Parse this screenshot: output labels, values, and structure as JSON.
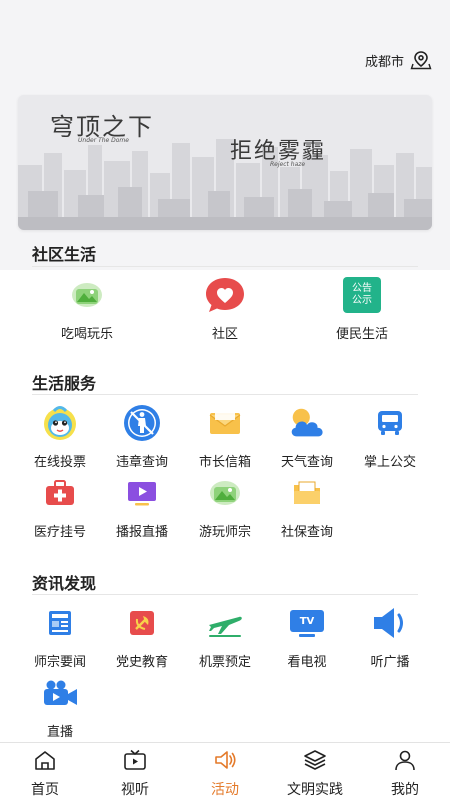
{
  "location": {
    "city": "成都市"
  },
  "banner": {
    "title_left": "穹顶之下",
    "subtitle_left": "Under The Dome",
    "title_right": "拒绝雾霾",
    "subtitle_right": "Reject haze"
  },
  "community": {
    "title": "社区生活",
    "items": [
      {
        "label": "吃喝玩乐",
        "icon": "mountain-image-icon"
      },
      {
        "label": "社区",
        "icon": "heart-bubble-icon"
      },
      {
        "label": "便民生活",
        "icon": "notice-board-icon",
        "badge_text": "公告公示"
      }
    ]
  },
  "services": {
    "title": "生活服务",
    "items": [
      {
        "label": "在线投票",
        "icon": "mascot-icon"
      },
      {
        "label": "违章查询",
        "icon": "no-pedestrian-icon"
      },
      {
        "label": "市长信箱",
        "icon": "envelope-icon"
      },
      {
        "label": "天气查询",
        "icon": "weather-icon"
      },
      {
        "label": "掌上公交",
        "icon": "bus-icon"
      },
      {
        "label": "医疗挂号",
        "icon": "medical-kit-icon"
      },
      {
        "label": "播报直播",
        "icon": "tv-play-icon"
      },
      {
        "label": "游玩师宗",
        "icon": "mountain-image-icon"
      },
      {
        "label": "社保查询",
        "icon": "folder-icon"
      }
    ]
  },
  "news": {
    "title": "资讯发现",
    "items": [
      {
        "label": "师宗要闻",
        "icon": "news-icon"
      },
      {
        "label": "党史教育",
        "icon": "party-emblem-icon"
      },
      {
        "label": "机票预定",
        "icon": "airplane-icon"
      },
      {
        "label": "看电视",
        "icon": "tv-icon",
        "badge_text": "TV"
      },
      {
        "label": "听广播",
        "icon": "speaker-icon"
      },
      {
        "label": "直播",
        "icon": "video-camera-icon"
      }
    ]
  },
  "tabbar": {
    "tabs": [
      {
        "label": "首页",
        "icon": "home-icon",
        "active": false
      },
      {
        "label": "视听",
        "icon": "tv-icon",
        "active": false
      },
      {
        "label": "活动",
        "icon": "speaker-icon",
        "active": true
      },
      {
        "label": "文明实践",
        "icon": "layers-icon",
        "active": false
      },
      {
        "label": "我的",
        "icon": "user-icon",
        "active": false
      }
    ]
  },
  "colors": {
    "accent": "#e47a2a",
    "blue": "#2f7fe6",
    "red": "#e74c4c",
    "green": "#2fae6a"
  }
}
